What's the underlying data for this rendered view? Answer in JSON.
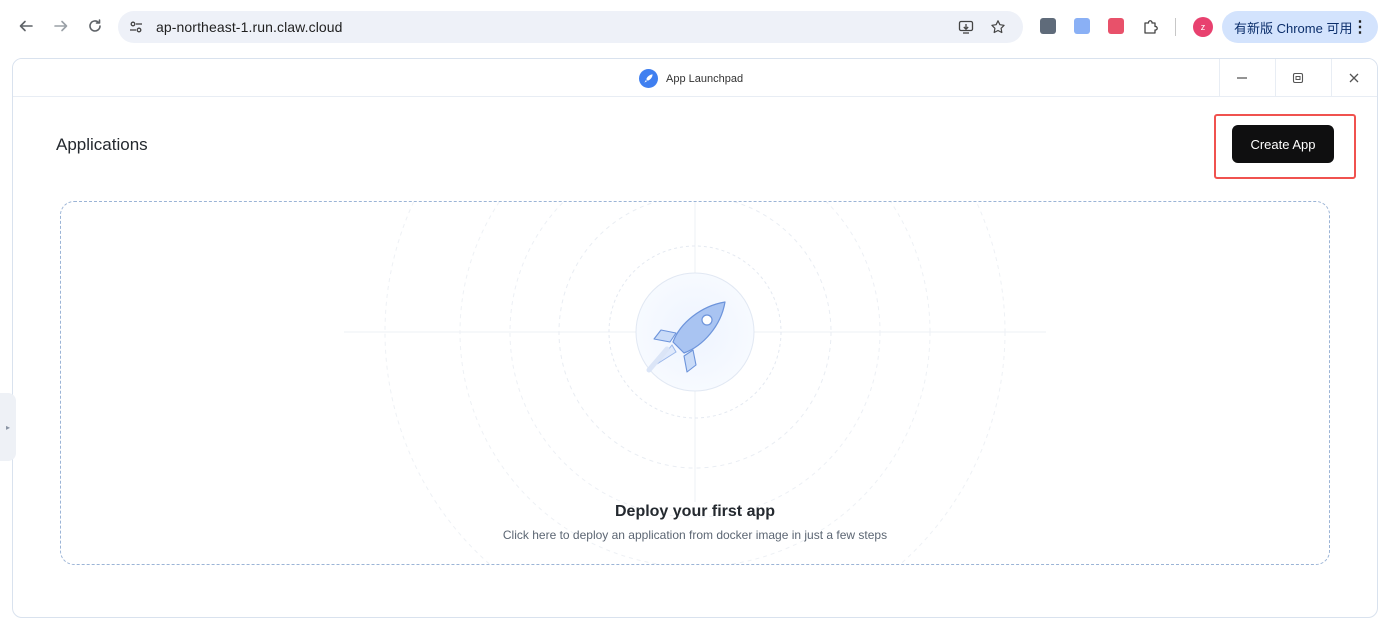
{
  "browser": {
    "url": "ap-northeast-1.run.claw.cloud",
    "profile_initial": "z",
    "update_label": "有新版 Chrome 可用",
    "icons": [
      "back-arrow-icon",
      "forward-arrow-icon",
      "reload-icon",
      "site-settings-icon",
      "install-app-icon",
      "bookmark-star-icon",
      "extensions-puzzle-icon",
      "menu-dots-icon"
    ],
    "colors": {
      "omnibox_bg": "#eef1f8",
      "update_pill_bg": "#d3e3fd",
      "avatar": "#e8416f"
    }
  },
  "window": {
    "title": "App Launchpad",
    "controls": [
      "minimize-icon",
      "restore-icon",
      "close-icon"
    ]
  },
  "page": {
    "title": "Applications",
    "create_button_label": "Create App",
    "empty_state": {
      "title": "Deploy your first app",
      "subtitle": "Click here to deploy an application from docker image in just a few steps"
    },
    "colors": {
      "primary_button": "#0f0f10",
      "highlight": "#f0524f",
      "dashed_border": "#9bb4d6"
    }
  }
}
